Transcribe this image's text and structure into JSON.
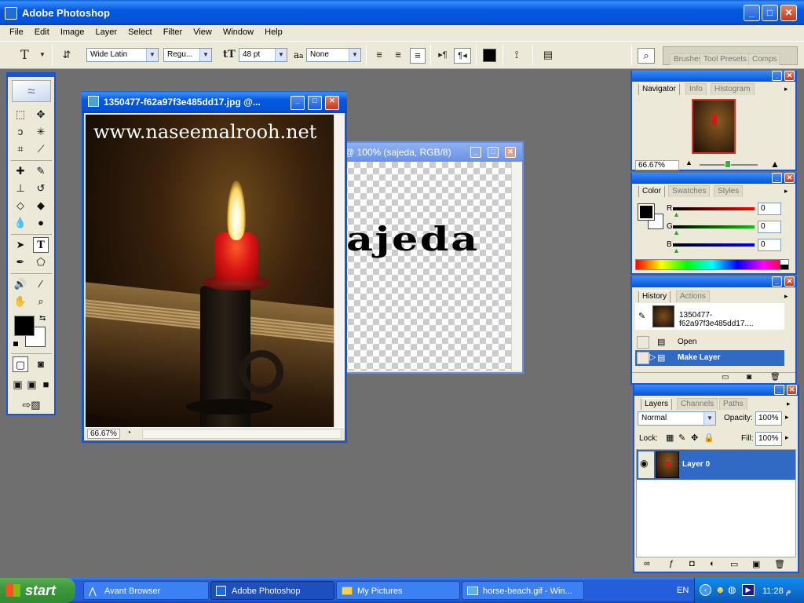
{
  "app": {
    "title": "Adobe Photoshop",
    "menu": [
      "File",
      "Edit",
      "Image",
      "Layer",
      "Select",
      "Filter",
      "View",
      "Window",
      "Help"
    ]
  },
  "options_bar": {
    "tool_icon": "T",
    "font_family": "Wide Latin",
    "font_style": "Regu...",
    "font_size": "48 pt",
    "anti_alias_prefix": "a",
    "anti_alias_sub": "a",
    "anti_alias": "None",
    "palette_well_tabs": [
      "Brushes",
      "Tool Presets",
      "Comps"
    ]
  },
  "doc1": {
    "title": "1350477-f62a97f3e485dd17.jpg @...",
    "watermark": "www.naseemalrooh.net",
    "zoom": "66.67%"
  },
  "doc2": {
    "title": "@ 100% (sajeda, RGB/8)",
    "text": "ajeda"
  },
  "navigator": {
    "tabs": [
      "Navigator",
      "Info",
      "Histogram"
    ],
    "zoom": "66.67%"
  },
  "color": {
    "tabs": [
      "Color",
      "Swatches",
      "Styles"
    ],
    "channels": [
      {
        "label": "R",
        "value": "0",
        "color": "#d00000"
      },
      {
        "label": "G",
        "value": "0",
        "color": "#00b000"
      },
      {
        "label": "B",
        "value": "0",
        "color": "#0000d0"
      }
    ]
  },
  "history": {
    "tabs": [
      "History",
      "Actions"
    ],
    "snapshot": "1350477-f62a97f3e485dd17....",
    "states": [
      "Open",
      "Make Layer"
    ]
  },
  "layers": {
    "tabs": [
      "Layers",
      "Channels",
      "Paths"
    ],
    "blend_mode": "Normal",
    "opacity_label": "Opacity:",
    "opacity": "100%",
    "lock_label": "Lock:",
    "fill_label": "Fill:",
    "fill": "100%",
    "layer_name": "Layer 0"
  },
  "taskbar": {
    "start": "start",
    "items": [
      "Avant Browser",
      "Adobe Photoshop",
      "My Pictures",
      "horse-beach.gif - Win..."
    ],
    "lang": "EN",
    "clock": "11:28 م"
  },
  "colors": {
    "xp_blue": "#0452d8",
    "workspace": "#6f6f6f",
    "selection": "#316ac5"
  }
}
